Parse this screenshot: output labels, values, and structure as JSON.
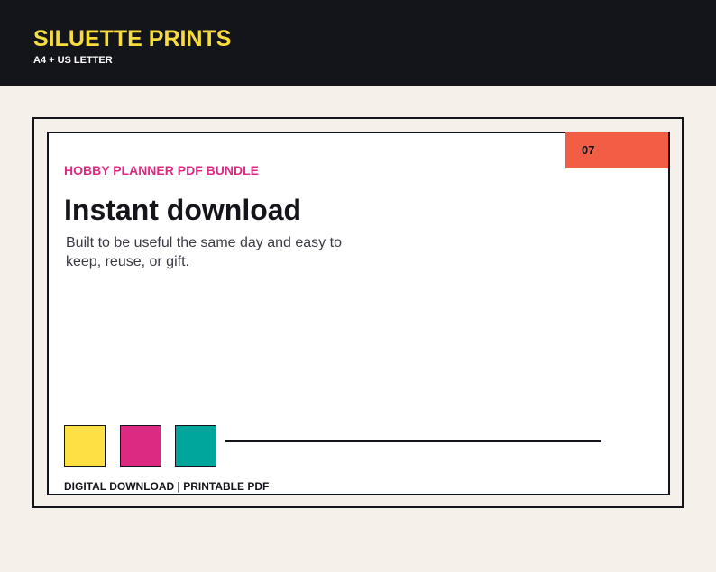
{
  "header": {
    "brand": "SILUETTE PRINTS",
    "format": "A4 + US LETTER"
  },
  "card": {
    "page_number": "07",
    "eyebrow": "HOBBY PLANNER PDF BUNDLE",
    "headline": "Instant download",
    "body": "Built to be useful the same day and easy to keep, reuse, or gift.",
    "footer": "DIGITAL DOWNLOAD | PRINTABLE PDF"
  },
  "palette": {
    "header_bg": "#14141b",
    "brand_yellow": "#f6dc3d",
    "page_bg": "#f5f0e9",
    "badge_coral": "#f15d45",
    "swatches": [
      "#ffe044",
      "#dc2a83",
      "#00a59b"
    ]
  }
}
